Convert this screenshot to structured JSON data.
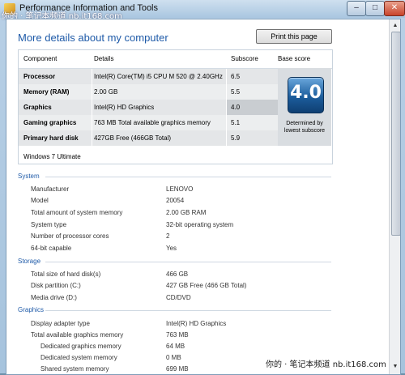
{
  "window": {
    "title": "Performance Information and Tools",
    "watermark_top": "你的 · 笔记本频道 nb.it168.com",
    "controls": {
      "minimize": "–",
      "maximize": "□",
      "close": "✕"
    }
  },
  "page": {
    "title": "More details about my computer",
    "print_label": "Print this page"
  },
  "summary": {
    "headers": {
      "component": "Component",
      "details": "Details",
      "subscore": "Subscore",
      "base": "Base score"
    },
    "rows": [
      {
        "component": "Processor",
        "details": "Intel(R) Core(TM) i5 CPU M 520 @ 2.40GHz",
        "subscore": "6.5"
      },
      {
        "component": "Memory (RAM)",
        "details": "2.00 GB",
        "subscore": "5.5"
      },
      {
        "component": "Graphics",
        "details": "Intel(R) HD Graphics",
        "subscore": "4.0"
      },
      {
        "component": "Gaming graphics",
        "details": "763 MB Total available graphics memory",
        "subscore": "5.1"
      },
      {
        "component": "Primary hard disk",
        "details": "427GB Free (466GB Total)",
        "subscore": "5.9"
      }
    ],
    "base_score": "4.0",
    "base_caption_1": "Determined by",
    "base_caption_2": "lowest subscore",
    "os": "Windows 7 Ultimate",
    "lowest_row_index": 2
  },
  "system": {
    "heading": "System",
    "items": [
      {
        "k": "Manufacturer",
        "v": "LENOVO"
      },
      {
        "k": "Model",
        "v": "20054"
      },
      {
        "k": "Total amount of system memory",
        "v": "2.00 GB RAM"
      },
      {
        "k": "System type",
        "v": "32-bit operating system"
      },
      {
        "k": "Number of processor cores",
        "v": "2"
      },
      {
        "k": "64-bit capable",
        "v": "Yes"
      }
    ]
  },
  "storage": {
    "heading": "Storage",
    "items": [
      {
        "k": "Total size of hard disk(s)",
        "v": "466 GB"
      },
      {
        "k": "Disk partition (C:)",
        "v": "427 GB Free (466 GB Total)"
      },
      {
        "k": "Media drive (D:)",
        "v": "CD/DVD"
      }
    ]
  },
  "graphics": {
    "heading": "Graphics",
    "items": [
      {
        "k": "Display adapter type",
        "v": "Intel(R) HD Graphics"
      },
      {
        "k": "Total available graphics memory",
        "v": "763 MB"
      },
      {
        "k": "Dedicated graphics memory",
        "v": "64 MB"
      },
      {
        "k": "Dedicated system memory",
        "v": "0 MB"
      },
      {
        "k": "Shared system memory",
        "v": "699 MB"
      }
    ]
  },
  "watermark_bottom": "你的 · 笔记本频道  nb.it168.com",
  "colors": {
    "accent": "#1e5aa8",
    "badge": "#1c5d9c"
  }
}
